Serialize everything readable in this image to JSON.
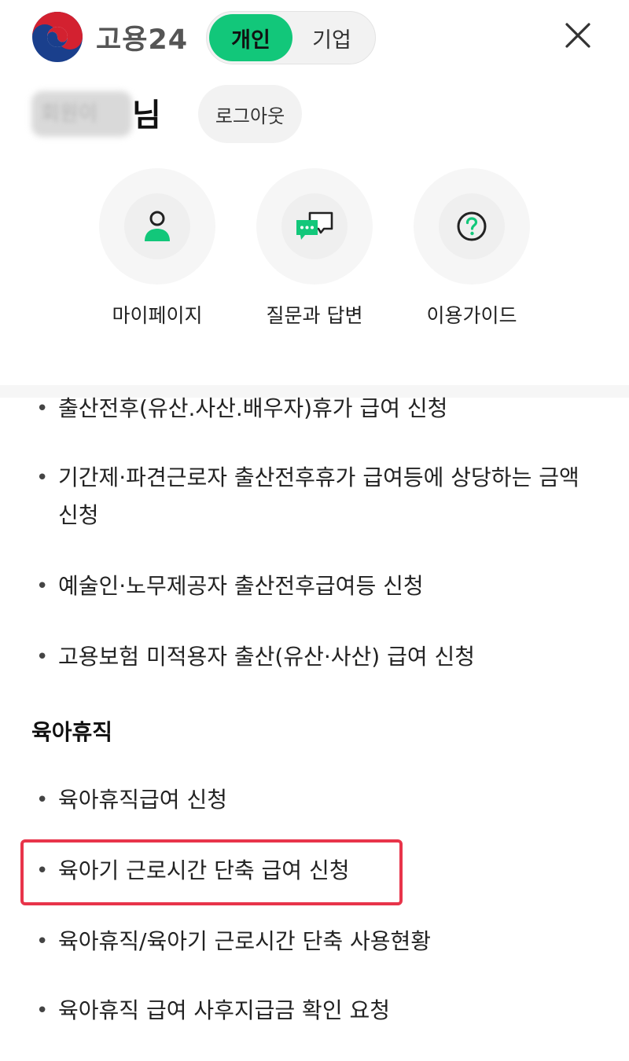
{
  "header": {
    "brand": "고용24",
    "toggle": {
      "personal": "개인",
      "company": "기업"
    },
    "close_icon": "close-icon"
  },
  "user": {
    "name_blurred": "회원이",
    "suffix": "님",
    "logout": "로그아웃"
  },
  "quick_menu": [
    {
      "label": "마이페이지",
      "icon": "person-icon"
    },
    {
      "label": "질문과 답변",
      "icon": "chat-icon"
    },
    {
      "label": "이용가이드",
      "icon": "question-icon"
    }
  ],
  "list": {
    "items_top": [
      "출산전후(유산.사산.배우자)휴가 급여 신청",
      "기간제·파견근로자 출산전후휴가 급여등에 상당하는 금액 신청",
      "예술인·노무제공자 출산전후급여등 신청",
      "고용보험 미적용자 출산(유산·사산) 급여 신청"
    ],
    "section_title": "육아휴직",
    "items_bottom": [
      "육아휴직급여 신청",
      "육아기 근로시간 단축 급여 신청",
      "육아휴직/육아기 근로시간 단축 사용현황",
      "육아휴직 급여 사후지급금 확인 요청"
    ],
    "bullet": "•"
  },
  "colors": {
    "accent": "#12c77a",
    "highlight": "#e8344a"
  }
}
